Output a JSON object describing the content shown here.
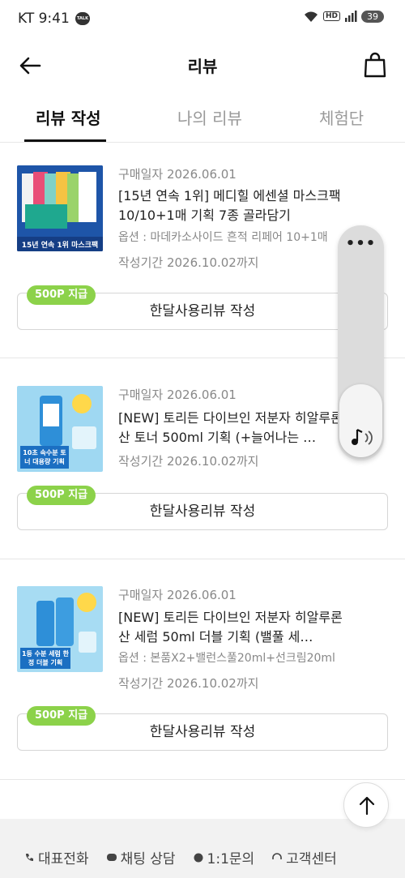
{
  "status": {
    "carrier_time": "KT 9:41",
    "talk": "TALK",
    "hd": "HD",
    "battery": "39"
  },
  "header": {
    "title": "리뷰"
  },
  "tabs": [
    {
      "label": "리뷰 작성",
      "active": true
    },
    {
      "label": "나의 리뷰",
      "active": false
    },
    {
      "label": "체험단",
      "active": false
    }
  ],
  "reviews": [
    {
      "purchase_date": "구매일자 2026.06.01",
      "name": "[15년 연속 1위] 메디힐 에센셜 마스크팩 10/10+1매 기획 7종 골라담기",
      "option": "옵션 : 마데카소사이드 흔적 리페어 10+1매",
      "period": "작성기간 2026.10.02까지",
      "badge": "500P 지급",
      "button": "한달사용리뷰 작성",
      "thumb_caption": "15년 연속 1위 마스크팩"
    },
    {
      "purchase_date": "구매일자 2026.06.01",
      "name": "[NEW] 토리든 다이브인 저분자 히알루론산 토너 500ml 기획 (+늘어나는 …",
      "period": "작성기간 2026.10.02까지",
      "badge": "500P 지급",
      "button": "한달사용리뷰 작성",
      "thumb_caption": "10초 속수분 토너 대용량 기획"
    },
    {
      "purchase_date": "구매일자 2026.06.01",
      "name": "[NEW] 토리든 다이브인 저분자 히알루론산 세럼 50ml 더블 기획 (밸풀 세…",
      "option": "옵션 : 본품X2+밸런스풀20ml+선크림20ml",
      "period": "작성기간 2026.10.02까지",
      "badge": "500P 지급",
      "button": "한달사용리뷰 작성",
      "thumb_caption": "1등 수분 세럼 한정 더블 기획"
    }
  ],
  "footer": {
    "links": [
      "대표전화",
      "채팅 상담",
      "1:1문의",
      "고객센터"
    ]
  },
  "colors": {
    "badge_green": "#8cd24a",
    "thumb_blue": "#2e8fd8"
  }
}
